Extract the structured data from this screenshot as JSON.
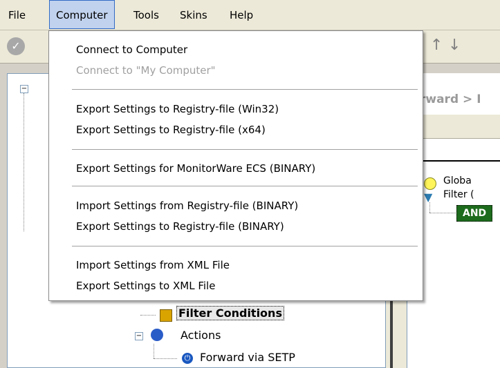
{
  "menubar": {
    "items": [
      {
        "label": "File"
      },
      {
        "label": "Computer"
      },
      {
        "label": "Tools"
      },
      {
        "label": "Skins"
      },
      {
        "label": "Help"
      }
    ],
    "active": "Computer"
  },
  "toolbar": {
    "icons": [
      "check-icon",
      "arrow-up-icon",
      "arrow-down-icon"
    ]
  },
  "dropdown": {
    "groups": [
      [
        {
          "label": "Connect to Computer",
          "enabled": true
        },
        {
          "label": "Connect to \"My Computer\"",
          "enabled": false
        }
      ],
      [
        {
          "label": "Export Settings to Registry-file (Win32)",
          "enabled": true
        },
        {
          "label": "Export Settings to Registry-file (x64)",
          "enabled": true
        }
      ],
      [
        {
          "label": "Export Settings for MonitorWare ECS (BINARY)",
          "enabled": true
        }
      ],
      [
        {
          "label": "Import Settings from Registry-file (BINARY)",
          "enabled": true
        },
        {
          "label": "Export Settings to Registry-file (BINARY)",
          "enabled": true
        }
      ],
      [
        {
          "label": "Import Settings from XML File",
          "enabled": true
        },
        {
          "label": "Export Settings to XML File",
          "enabled": true
        }
      ]
    ]
  },
  "tree": {
    "filter_conditions": "Filter Conditions",
    "actions": "Actions",
    "forward_via_setp": "Forward via SETP"
  },
  "right_panel": {
    "breadcrumb": "rward > I",
    "global_row": "Globa",
    "filter_row": "Filter (",
    "and_badge": "AND"
  }
}
